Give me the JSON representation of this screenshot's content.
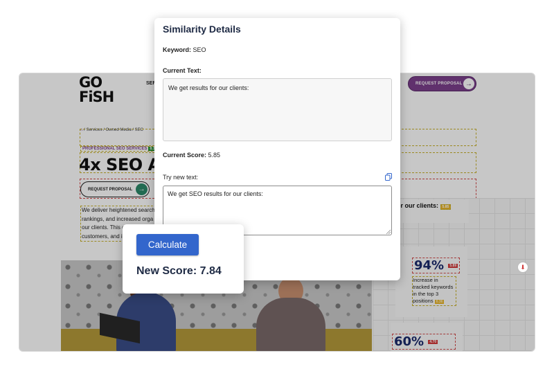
{
  "website": {
    "logo_line1": "GO",
    "logo_line2": "FiSH",
    "nav_services": "SEF",
    "request_proposal_top": "REQUEST PROPOSAL",
    "breadcrumb": "/  Services  /  Owned Media  /  SEC",
    "tag_label": "PROFESSIONAL SEO SERVICES",
    "tag_score": "8.35",
    "hero_title": "4x SEO A",
    "request_proposal_hero": "REQUEST PROPOSAL",
    "paragraph_lines": [
      "We deliver heightened search",
      "rankings, and increased orga",
      "our clients. This c",
      "customers, and i"
    ],
    "clients_card_text": "for our clients:",
    "clients_card_score": "5.85",
    "stat1_value": "94%",
    "stat1_score": "5.89",
    "stat1_desc": "Increase in tracked keywords in the top 3 positions",
    "stat1_desc_score": "6.36",
    "stat2_value": "60%",
    "stat2_score": "4.70",
    "pdf_icon": "pdf-icon"
  },
  "modal": {
    "title": "Similarity Details",
    "keyword_label": "Keyword:",
    "keyword_value": "SEO",
    "current_text_label": "Current Text:",
    "current_text_value": "We get results for our clients:",
    "current_score_label": "Current Score:",
    "current_score_value": "5.85",
    "try_label": "Try new text:",
    "try_value": "We get SEO results for our clients:",
    "copy_icon": "copy-icon"
  },
  "calculator": {
    "button_label": "Calculate",
    "new_score_label": "New Score:",
    "new_score_value": "7.84"
  },
  "colors": {
    "primary_button": "#3366cc",
    "brand_purple": "#7b3f8c",
    "title_text": "#1e2a44"
  }
}
